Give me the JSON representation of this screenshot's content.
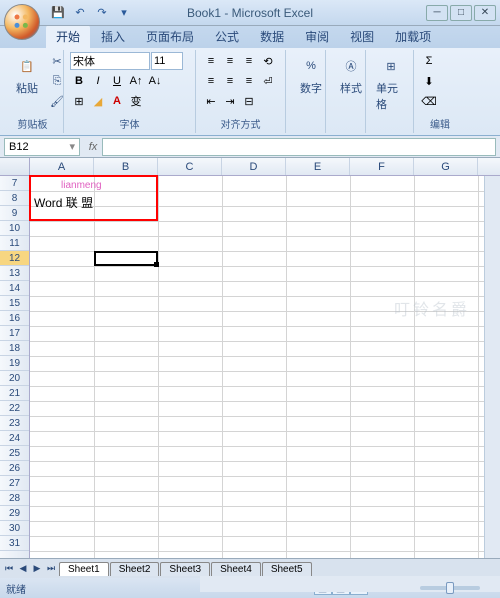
{
  "title": "Book1 - Microsoft Excel",
  "tabs": [
    "开始",
    "插入",
    "页面布局",
    "公式",
    "数据",
    "审阅",
    "视图",
    "加载项"
  ],
  "activeTab": 0,
  "ribbon": {
    "clipboard": {
      "label": "剪贴板",
      "paste": "粘贴"
    },
    "font": {
      "label": "字体",
      "name": "宋体",
      "size": "11"
    },
    "align": {
      "label": "对齐方式"
    },
    "number": {
      "label": "数字",
      "btn": "数字"
    },
    "styles": {
      "label": "样式",
      "btn": "样式"
    },
    "cells": {
      "label": "单元格",
      "btn": "单元格"
    },
    "editing": {
      "label": "编辑"
    }
  },
  "namebox": "B12",
  "columns": [
    "A",
    "B",
    "C",
    "D",
    "E",
    "F",
    "G"
  ],
  "rows": [
    7,
    8,
    9,
    10,
    11,
    12,
    13,
    14,
    15,
    16,
    17,
    18,
    19,
    20,
    21,
    22,
    23,
    24,
    25,
    26,
    27,
    28,
    29,
    30,
    31
  ],
  "selectedRow": 12,
  "redbox_watermark": "lianmeng",
  "cellA8": "Word 联 盟",
  "sheets": [
    "Sheet1",
    "Sheet2",
    "Sheet3",
    "Sheet4",
    "Sheet5"
  ],
  "status": "就绪",
  "zoom": "100%",
  "watermark": "叮铃名爵"
}
